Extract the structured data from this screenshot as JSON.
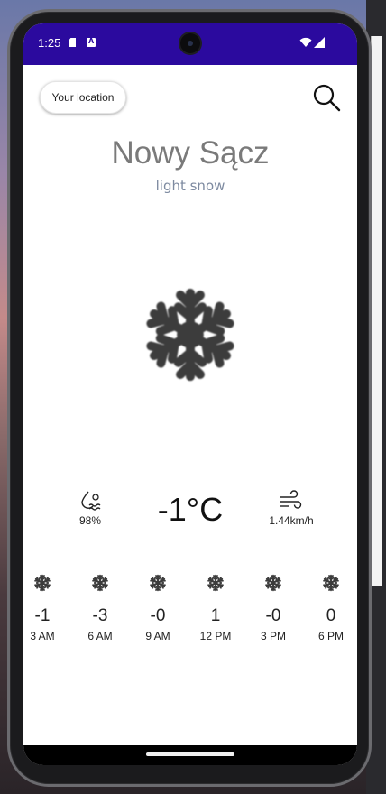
{
  "status_bar": {
    "time": "1:25",
    "background": "#2b0a9e"
  },
  "header": {
    "location_button": "Your location",
    "search_icon": "search-icon"
  },
  "weather": {
    "city": "Nowy Sącz",
    "description": "light snow",
    "icon": "snowflake-icon",
    "temperature": "-1°C",
    "humidity": "98%",
    "wind_speed": "1.44km/h"
  },
  "hourly": [
    {
      "icon": "snowflake-icon",
      "temp": "-1",
      "time": "3 AM"
    },
    {
      "icon": "snowflake-icon",
      "temp": "-3",
      "time": "6 AM"
    },
    {
      "icon": "snowflake-icon",
      "temp": "-0",
      "time": "9 AM"
    },
    {
      "icon": "snowflake-icon",
      "temp": "1",
      "time": "12 PM"
    },
    {
      "icon": "snowflake-icon",
      "temp": "-0",
      "time": "3 PM"
    },
    {
      "icon": "snowflake-icon",
      "temp": "0",
      "time": "6 PM"
    }
  ]
}
